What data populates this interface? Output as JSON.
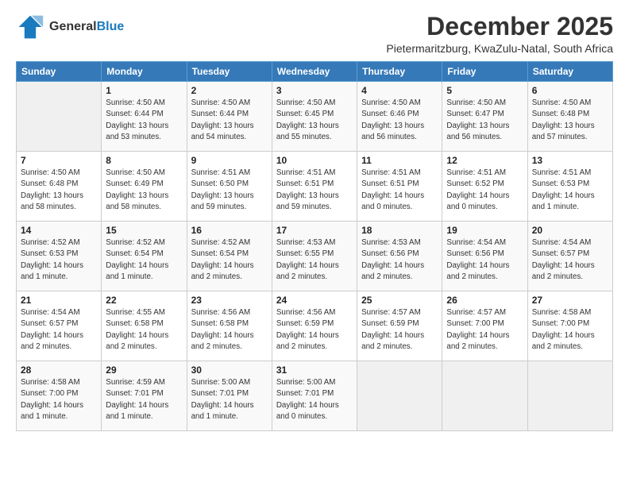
{
  "logo": {
    "general": "General",
    "blue": "Blue"
  },
  "header": {
    "title": "December 2025",
    "subtitle": "Pietermaritzburg, KwaZulu-Natal, South Africa"
  },
  "weekdays": [
    "Sunday",
    "Monday",
    "Tuesday",
    "Wednesday",
    "Thursday",
    "Friday",
    "Saturday"
  ],
  "weeks": [
    [
      {
        "day": "",
        "empty": true
      },
      {
        "day": "1",
        "sunrise": "Sunrise: 4:50 AM",
        "sunset": "Sunset: 6:44 PM",
        "daylight": "Daylight: 13 hours and 53 minutes."
      },
      {
        "day": "2",
        "sunrise": "Sunrise: 4:50 AM",
        "sunset": "Sunset: 6:44 PM",
        "daylight": "Daylight: 13 hours and 54 minutes."
      },
      {
        "day": "3",
        "sunrise": "Sunrise: 4:50 AM",
        "sunset": "Sunset: 6:45 PM",
        "daylight": "Daylight: 13 hours and 55 minutes."
      },
      {
        "day": "4",
        "sunrise": "Sunrise: 4:50 AM",
        "sunset": "Sunset: 6:46 PM",
        "daylight": "Daylight: 13 hours and 56 minutes."
      },
      {
        "day": "5",
        "sunrise": "Sunrise: 4:50 AM",
        "sunset": "Sunset: 6:47 PM",
        "daylight": "Daylight: 13 hours and 56 minutes."
      },
      {
        "day": "6",
        "sunrise": "Sunrise: 4:50 AM",
        "sunset": "Sunset: 6:48 PM",
        "daylight": "Daylight: 13 hours and 57 minutes."
      }
    ],
    [
      {
        "day": "7",
        "sunrise": "Sunrise: 4:50 AM",
        "sunset": "Sunset: 6:48 PM",
        "daylight": "Daylight: 13 hours and 58 minutes."
      },
      {
        "day": "8",
        "sunrise": "Sunrise: 4:50 AM",
        "sunset": "Sunset: 6:49 PM",
        "daylight": "Daylight: 13 hours and 58 minutes."
      },
      {
        "day": "9",
        "sunrise": "Sunrise: 4:51 AM",
        "sunset": "Sunset: 6:50 PM",
        "daylight": "Daylight: 13 hours and 59 minutes."
      },
      {
        "day": "10",
        "sunrise": "Sunrise: 4:51 AM",
        "sunset": "Sunset: 6:51 PM",
        "daylight": "Daylight: 13 hours and 59 minutes."
      },
      {
        "day": "11",
        "sunrise": "Sunrise: 4:51 AM",
        "sunset": "Sunset: 6:51 PM",
        "daylight": "Daylight: 14 hours and 0 minutes."
      },
      {
        "day": "12",
        "sunrise": "Sunrise: 4:51 AM",
        "sunset": "Sunset: 6:52 PM",
        "daylight": "Daylight: 14 hours and 0 minutes."
      },
      {
        "day": "13",
        "sunrise": "Sunrise: 4:51 AM",
        "sunset": "Sunset: 6:53 PM",
        "daylight": "Daylight: 14 hours and 1 minute."
      }
    ],
    [
      {
        "day": "14",
        "sunrise": "Sunrise: 4:52 AM",
        "sunset": "Sunset: 6:53 PM",
        "daylight": "Daylight: 14 hours and 1 minute."
      },
      {
        "day": "15",
        "sunrise": "Sunrise: 4:52 AM",
        "sunset": "Sunset: 6:54 PM",
        "daylight": "Daylight: 14 hours and 1 minute."
      },
      {
        "day": "16",
        "sunrise": "Sunrise: 4:52 AM",
        "sunset": "Sunset: 6:54 PM",
        "daylight": "Daylight: 14 hours and 2 minutes."
      },
      {
        "day": "17",
        "sunrise": "Sunrise: 4:53 AM",
        "sunset": "Sunset: 6:55 PM",
        "daylight": "Daylight: 14 hours and 2 minutes."
      },
      {
        "day": "18",
        "sunrise": "Sunrise: 4:53 AM",
        "sunset": "Sunset: 6:56 PM",
        "daylight": "Daylight: 14 hours and 2 minutes."
      },
      {
        "day": "19",
        "sunrise": "Sunrise: 4:54 AM",
        "sunset": "Sunset: 6:56 PM",
        "daylight": "Daylight: 14 hours and 2 minutes."
      },
      {
        "day": "20",
        "sunrise": "Sunrise: 4:54 AM",
        "sunset": "Sunset: 6:57 PM",
        "daylight": "Daylight: 14 hours and 2 minutes."
      }
    ],
    [
      {
        "day": "21",
        "sunrise": "Sunrise: 4:54 AM",
        "sunset": "Sunset: 6:57 PM",
        "daylight": "Daylight: 14 hours and 2 minutes."
      },
      {
        "day": "22",
        "sunrise": "Sunrise: 4:55 AM",
        "sunset": "Sunset: 6:58 PM",
        "daylight": "Daylight: 14 hours and 2 minutes."
      },
      {
        "day": "23",
        "sunrise": "Sunrise: 4:56 AM",
        "sunset": "Sunset: 6:58 PM",
        "daylight": "Daylight: 14 hours and 2 minutes."
      },
      {
        "day": "24",
        "sunrise": "Sunrise: 4:56 AM",
        "sunset": "Sunset: 6:59 PM",
        "daylight": "Daylight: 14 hours and 2 minutes."
      },
      {
        "day": "25",
        "sunrise": "Sunrise: 4:57 AM",
        "sunset": "Sunset: 6:59 PM",
        "daylight": "Daylight: 14 hours and 2 minutes."
      },
      {
        "day": "26",
        "sunrise": "Sunrise: 4:57 AM",
        "sunset": "Sunset: 7:00 PM",
        "daylight": "Daylight: 14 hours and 2 minutes."
      },
      {
        "day": "27",
        "sunrise": "Sunrise: 4:58 AM",
        "sunset": "Sunset: 7:00 PM",
        "daylight": "Daylight: 14 hours and 2 minutes."
      }
    ],
    [
      {
        "day": "28",
        "sunrise": "Sunrise: 4:58 AM",
        "sunset": "Sunset: 7:00 PM",
        "daylight": "Daylight: 14 hours and 1 minute."
      },
      {
        "day": "29",
        "sunrise": "Sunrise: 4:59 AM",
        "sunset": "Sunset: 7:01 PM",
        "daylight": "Daylight: 14 hours and 1 minute."
      },
      {
        "day": "30",
        "sunrise": "Sunrise: 5:00 AM",
        "sunset": "Sunset: 7:01 PM",
        "daylight": "Daylight: 14 hours and 1 minute."
      },
      {
        "day": "31",
        "sunrise": "Sunrise: 5:00 AM",
        "sunset": "Sunset: 7:01 PM",
        "daylight": "Daylight: 14 hours and 0 minutes."
      },
      {
        "day": "",
        "empty": true
      },
      {
        "day": "",
        "empty": true
      },
      {
        "day": "",
        "empty": true
      }
    ]
  ]
}
